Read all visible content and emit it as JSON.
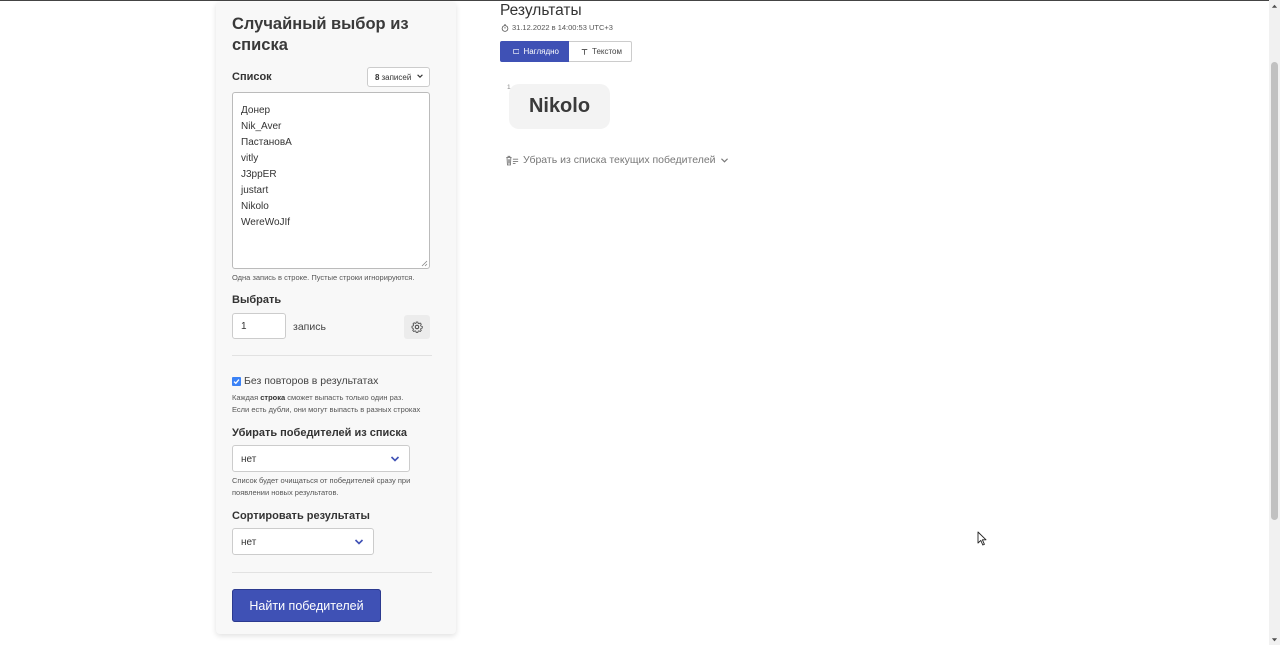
{
  "form": {
    "title": "Случайный выбор из списка",
    "list_label": "Список",
    "count_select": {
      "count": "8",
      "unit": "записей"
    },
    "list_items": [
      "Донер",
      "Nik_Aver",
      "ПастановA",
      "vitly",
      "J3ppER",
      "justart",
      "Nikolo",
      "WereWoJIf"
    ],
    "list_hint": "Одна запись в строке. Пустые строки игнорируются.",
    "pick_label": "Выбрать",
    "pick_value": "1",
    "pick_unit": "запись",
    "no_repeat": {
      "checked": true,
      "label": "Без повторов в результатах",
      "hint_before": "Каждая ",
      "hint_bold": "строка",
      "hint_after": " сможет выпасть только один раз.",
      "hint_line2": "Если есть дубли, они могут выпасть в разных строках"
    },
    "remove_winners": {
      "label": "Убирать победителей из списка",
      "value": "нет",
      "hint_line1": "Список будет очищаться от победителей сразу при",
      "hint_line2": "появлении новых результатов."
    },
    "sort": {
      "label": "Сортировать результаты",
      "value": "нет"
    },
    "submit_label": "Найти победителей"
  },
  "results": {
    "title": "Результаты",
    "timestamp": "31.12.2022 в 14:00:53 UTC+3",
    "tabs": [
      {
        "label": "Наглядно",
        "active": true
      },
      {
        "label": "Текстом",
        "active": false
      }
    ],
    "winners": [
      {
        "index": "1",
        "name": "Nikolo"
      }
    ],
    "remove_current_label": "Убрать из списка текущих победителей"
  },
  "colors": {
    "accent": "#3f51b5",
    "checkbox": "#3b82f6",
    "card_bg": "#f8f8f8"
  }
}
